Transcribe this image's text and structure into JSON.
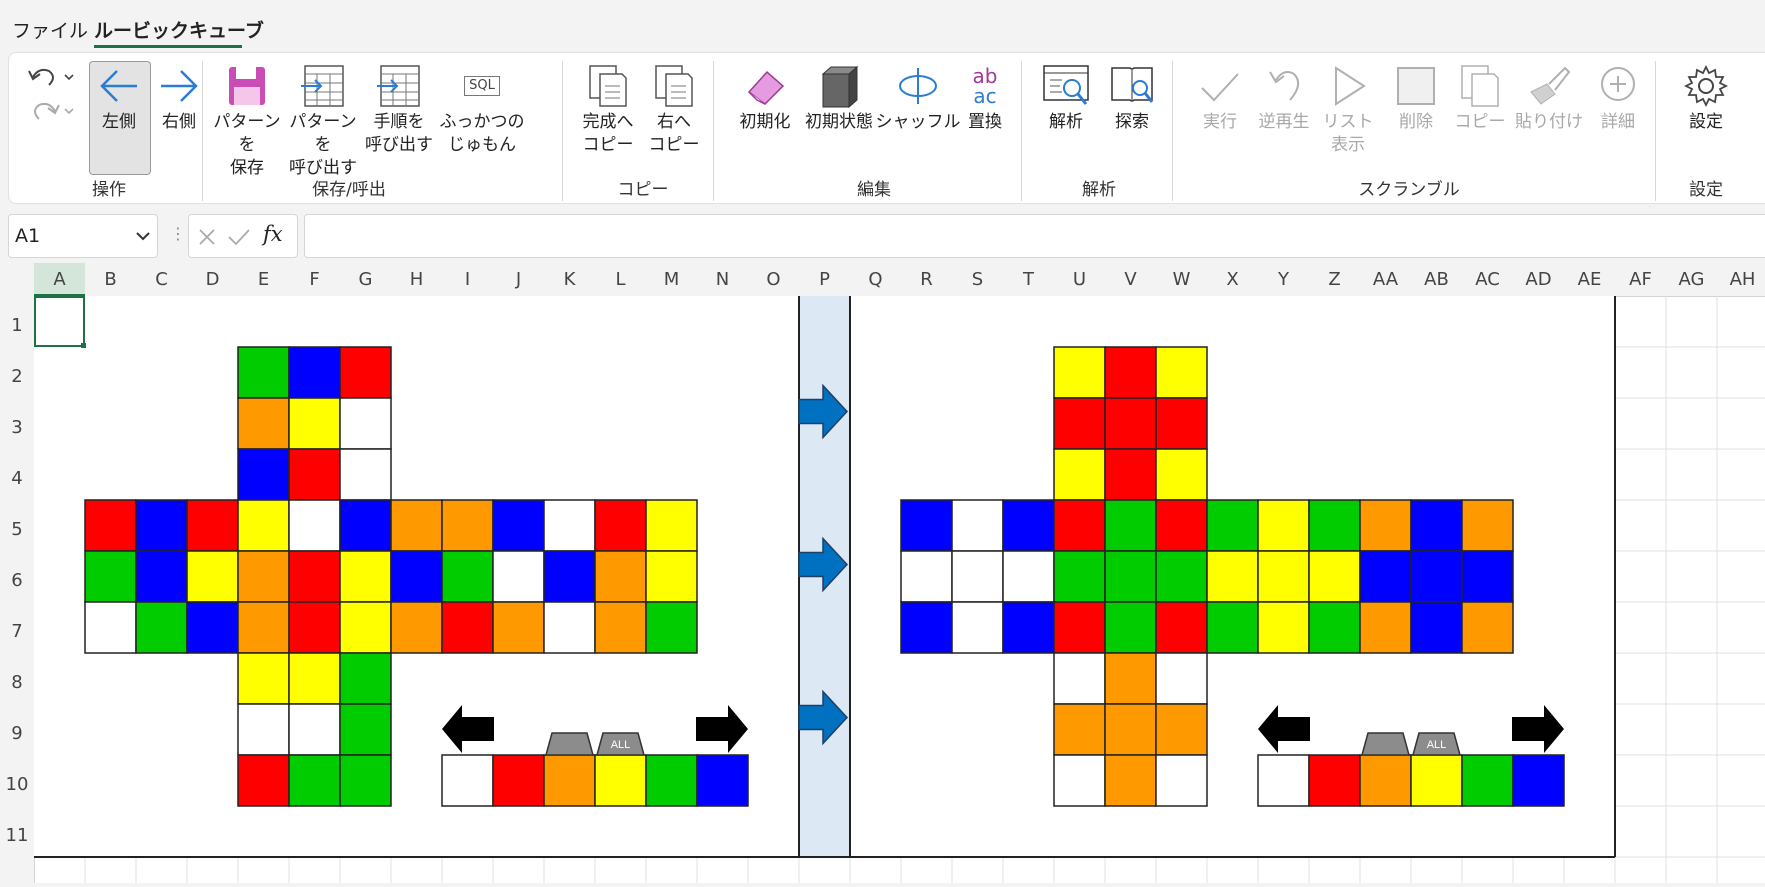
{
  "menu": {
    "file": "ファイル",
    "active_tab": "ルービックキューブ"
  },
  "ribbon": {
    "undo_label": "",
    "left_label": "左側",
    "right_label": "右側",
    "save_pattern": [
      "パターンを",
      "保存"
    ],
    "recall_pattern": [
      "パターンを",
      "呼び出す"
    ],
    "recall_steps": [
      "手順を",
      "呼び出す"
    ],
    "restore_spell": [
      "ふっかつの",
      "じゅもん"
    ],
    "sql_icon_text": "SQL",
    "copy_done": [
      "完成へ",
      "コピー"
    ],
    "copy_right": [
      "右へ",
      "コピー"
    ],
    "init": "初期化",
    "init_state": "初期状態",
    "shuffle": "シャッフル",
    "replace": "置換",
    "replace_icon_top": "ab",
    "replace_icon_bottom": "ac",
    "analyze": "解析",
    "search": "探索",
    "run": "実行",
    "reverse": "逆再生",
    "list_view": [
      "リスト",
      "表示"
    ],
    "delete": "削除",
    "copy": "コピー",
    "paste": "貼り付け",
    "detail": "詳細",
    "settings": "設定",
    "groups": {
      "operation": "操作",
      "save_recall": "保存/呼出",
      "copy": "コピー",
      "edit": "編集",
      "analysis": "解析",
      "scramble": "スクランブル",
      "settings": "設定"
    }
  },
  "formula": {
    "cell_ref": "A1",
    "fx": "fx",
    "content": ""
  },
  "columns": [
    "A",
    "B",
    "C",
    "D",
    "E",
    "F",
    "G",
    "H",
    "I",
    "J",
    "K",
    "L",
    "M",
    "N",
    "O",
    "P",
    "Q",
    "R",
    "S",
    "T",
    "U",
    "V",
    "W",
    "X",
    "Y",
    "Z",
    "AA",
    "AB",
    "AC",
    "AD",
    "AE",
    "AF",
    "AG",
    "AH"
  ],
  "rows": [
    "1",
    "2",
    "3",
    "4",
    "5",
    "6",
    "7",
    "8",
    "9",
    "10",
    "11"
  ],
  "palette_label": "ALL",
  "colors": {
    "W": "#ffffff",
    "R": "#ff0000",
    "O": "#ff9900",
    "Y": "#ffff00",
    "G": "#00cc00",
    "B": "#0000ff",
    "arrow": "#0070c0",
    "divider": "#dce9f5",
    "accent": "#1e7145"
  },
  "palette": [
    "W",
    "R",
    "O",
    "Y",
    "G",
    "B"
  ],
  "cube_left": {
    "top": [
      [
        "G",
        "B",
        "R"
      ],
      [
        "O",
        "Y",
        "W"
      ],
      [
        "B",
        "R",
        "W"
      ]
    ],
    "middle": [
      [
        "R",
        "B",
        "R",
        "Y",
        "W",
        "B",
        "O",
        "O",
        "B",
        "W",
        "R",
        "Y"
      ],
      [
        "G",
        "B",
        "Y",
        "O",
        "R",
        "Y",
        "B",
        "G",
        "W",
        "B",
        "O",
        "Y"
      ],
      [
        "W",
        "G",
        "B",
        "O",
        "R",
        "Y",
        "O",
        "R",
        "O",
        "W",
        "O",
        "G"
      ]
    ],
    "bottom": [
      [
        "Y",
        "Y",
        "G"
      ],
      [
        "W",
        "W",
        "G"
      ],
      [
        "R",
        "G",
        "G"
      ]
    ]
  },
  "cube_right": {
    "top": [
      [
        "Y",
        "R",
        "Y"
      ],
      [
        "R",
        "R",
        "R"
      ],
      [
        "Y",
        "R",
        "Y"
      ]
    ],
    "middle": [
      [
        "B",
        "W",
        "B",
        "R",
        "G",
        "R",
        "G",
        "Y",
        "G",
        "O",
        "B",
        "O"
      ],
      [
        "W",
        "W",
        "W",
        "G",
        "G",
        "G",
        "Y",
        "Y",
        "Y",
        "B",
        "B",
        "B"
      ],
      [
        "B",
        "W",
        "B",
        "R",
        "G",
        "R",
        "G",
        "Y",
        "G",
        "O",
        "B",
        "O"
      ]
    ],
    "bottom": [
      [
        "W",
        "O",
        "W"
      ],
      [
        "O",
        "O",
        "O"
      ],
      [
        "W",
        "O",
        "W"
      ]
    ]
  }
}
